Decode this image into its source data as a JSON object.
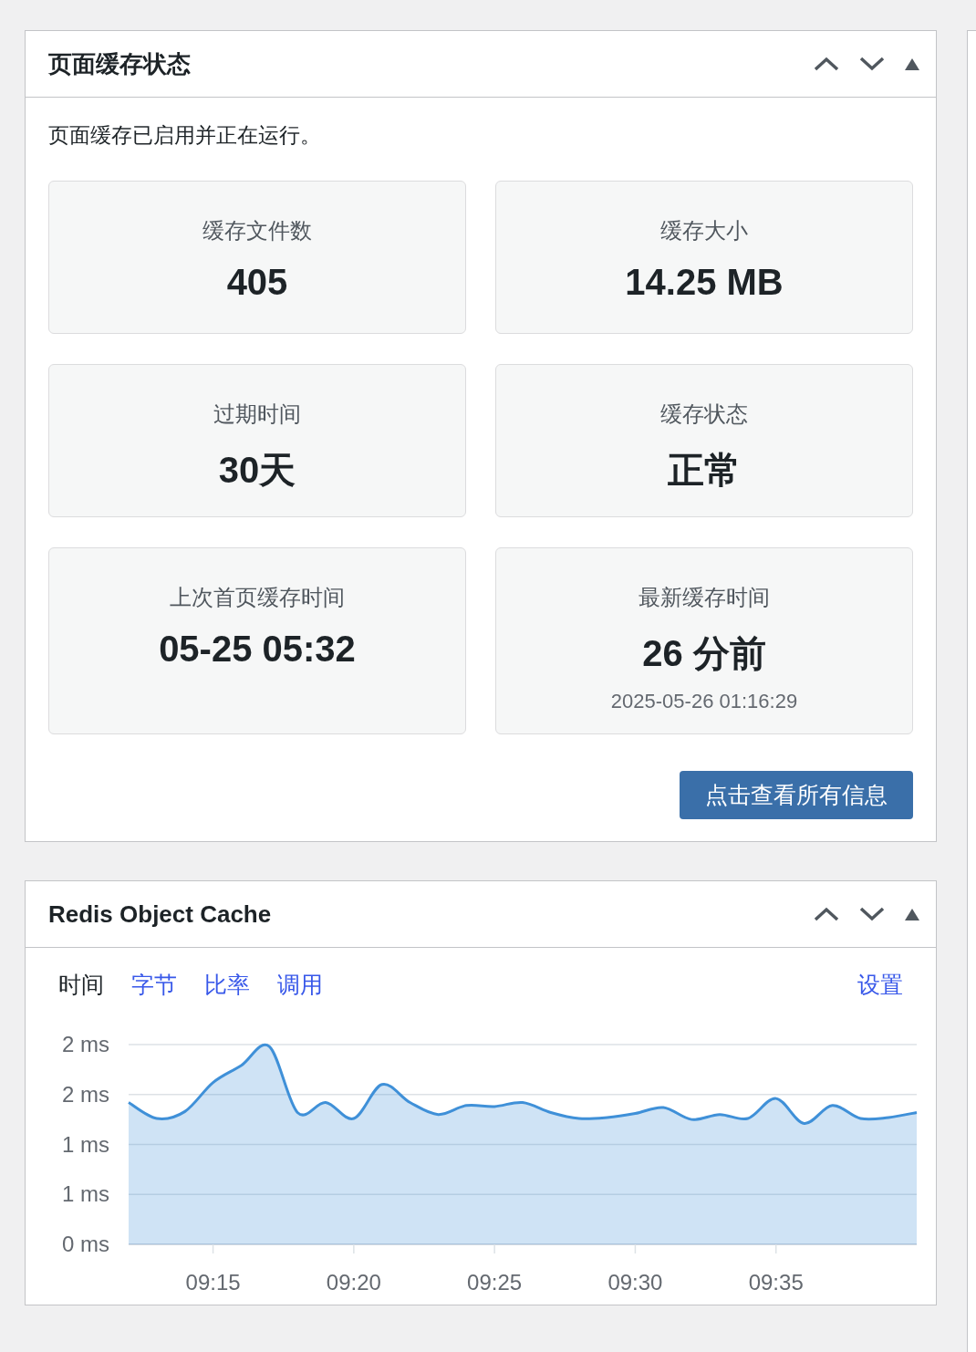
{
  "page_cache_panel": {
    "title": "页面缓存状态",
    "status_text": "页面缓存已启用并正在运行。",
    "stats": [
      {
        "label": "缓存文件数",
        "value": "405"
      },
      {
        "label": "缓存大小",
        "value": "14.25 MB"
      },
      {
        "label": "过期时间",
        "value": "30天"
      },
      {
        "label": "缓存状态",
        "value": "正常"
      },
      {
        "label": "上次首页缓存时间",
        "value": "05-25 05:32"
      },
      {
        "label": "最新缓存时间",
        "value": "26 分前",
        "detail": "2025-05-26 01:16:29"
      }
    ],
    "button": "点击查看所有信息"
  },
  "redis_panel": {
    "title": "Redis Object Cache",
    "tabs": [
      {
        "label": "时间",
        "selected": true
      },
      {
        "label": "字节",
        "selected": false
      },
      {
        "label": "比率",
        "selected": false
      },
      {
        "label": "调用",
        "selected": false
      }
    ],
    "settings_link": "设置",
    "chart_data": {
      "type": "area",
      "categories": [
        null,
        null,
        null,
        "09:15",
        null,
        null,
        null,
        null,
        "09:20",
        null,
        null,
        null,
        null,
        "09:25",
        null,
        null,
        null,
        null,
        "09:30",
        null,
        null,
        null,
        null,
        "09:35",
        null,
        null,
        null,
        null,
        null
      ],
      "grid": true,
      "series": [
        {
          "color": "#3f90d8",
          "values": [
            1.42,
            1.26,
            1.33,
            1.62,
            1.79,
            1.98,
            1.32,
            1.42,
            1.26,
            1.6,
            1.42,
            1.3,
            1.39,
            1.38,
            1.42,
            1.32,
            1.26,
            1.27,
            1.31,
            1.37,
            1.25,
            1.3,
            1.26,
            1.46,
            1.21,
            1.39,
            1.26,
            1.27,
            1.32
          ]
        }
      ],
      "ylim": [
        0,
        2
      ],
      "yticks": [
        {
          "value": 2,
          "label": "2 ms"
        },
        {
          "value": 1.5,
          "label": "2 ms"
        },
        {
          "value": 1,
          "label": "1 ms"
        },
        {
          "value": 0.5,
          "label": "1 ms"
        },
        {
          "value": 0,
          "label": "0 ms"
        }
      ]
    }
  }
}
